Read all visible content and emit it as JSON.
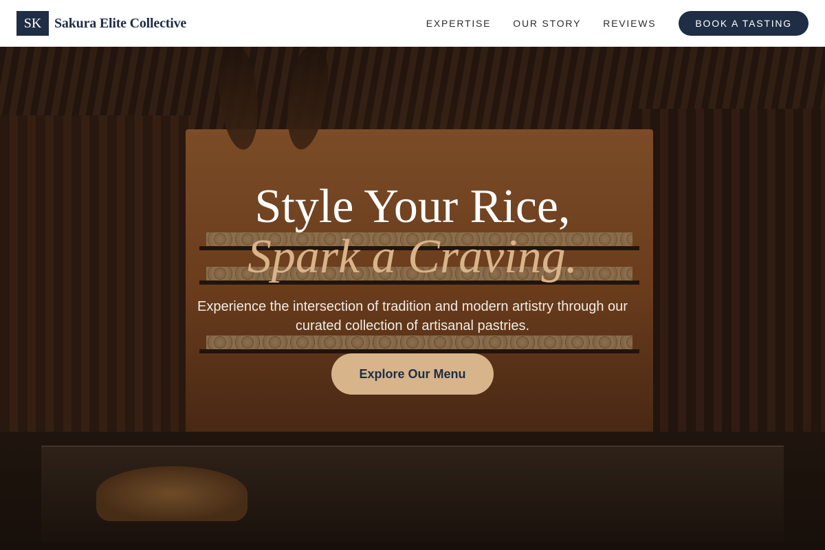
{
  "brand": {
    "mark": "SK",
    "name": "Sakura Elite Collective"
  },
  "nav": {
    "items": [
      "EXPERTISE",
      "OUR STORY",
      "REVIEWS"
    ],
    "cta_label": "BOOK A TASTING"
  },
  "hero": {
    "headline": "Style Your Rice,",
    "headline_accent": "Spark a Craving.",
    "subtext": "Experience the intersection of tradition and modern artistry through our curated collection of artisanal pastries.",
    "button_label": "Explore Our Menu",
    "background_subject": "bakery-interior-photo"
  },
  "colors": {
    "navy": "#1f2d45",
    "accent_tan": "#d8b48a",
    "white": "#ffffff"
  }
}
